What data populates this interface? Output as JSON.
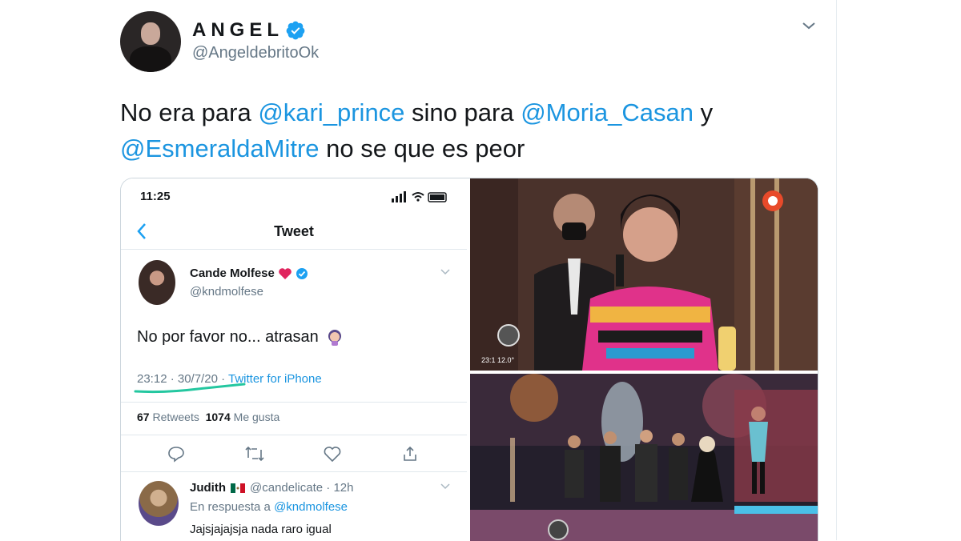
{
  "author": {
    "name": "ANGEL",
    "handle": "@AngeldebritoOk"
  },
  "tweet": {
    "text_parts": [
      {
        "t": "No era para ",
        "mention": false
      },
      {
        "t": "@kari_prince",
        "mention": true
      },
      {
        "t": " sino para ",
        "mention": false
      },
      {
        "t": "@Moria_Casan",
        "mention": true
      },
      {
        "t": " y ",
        "mention": false
      },
      {
        "t": "@EsmeraldaMitre",
        "mention": true
      },
      {
        "t": " no se que es peor",
        "mention": false
      }
    ]
  },
  "screenshot": {
    "status_time": "11:25",
    "title": "Tweet",
    "inner_name": "Cande Molfese",
    "inner_handle": "@kndmolfese",
    "inner_text": "No por favor no... atrasan",
    "meta_time": "23:12 · 30/7/20 · ",
    "meta_source": "Twitter for iPhone",
    "retweets_count": "67",
    "retweets_label": "Retweets",
    "likes_count": "1074",
    "likes_label": "Me gusta",
    "reply_name": "Judith",
    "reply_handle": "@candelicate · 12h",
    "reply_to_label": "En respuesta a",
    "reply_to_handle": "@kndmolfese",
    "reply_text": "Jajsjajajsja nada raro igual"
  },
  "photos": {
    "top_overlay": "23:1 12.0°"
  },
  "colors": {
    "mention": "#1b95e0",
    "verified": "#1da1f2",
    "secondary_text": "#657786"
  }
}
